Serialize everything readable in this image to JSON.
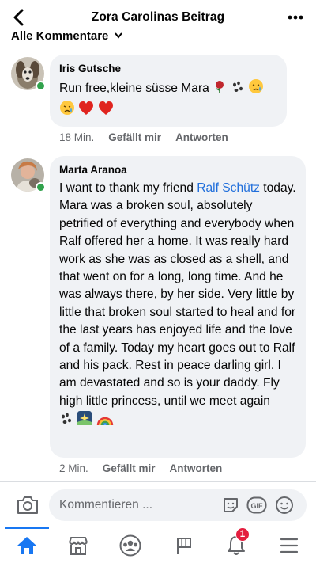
{
  "header": {
    "title": "Zora Carolinas Beitrag"
  },
  "section": {
    "label": "Alle Kommentare"
  },
  "comments": [
    {
      "author": "Iris Gutsche",
      "text_parts": [
        "Run free,kleine süsse Mara "
      ],
      "emojis_line1": [
        "rose-icon",
        "paw-prints-icon",
        "sad-tear-face-icon"
      ],
      "emojis_line2": [
        "sad-tear-face-icon",
        "red-heart-icon",
        "red-heart-icon"
      ],
      "time": "18 Min.",
      "like_label": "Gefällt mir",
      "reply_label": "Antworten",
      "online": true
    },
    {
      "author": "Marta Aranoa",
      "text_before_mention": "I want to thank my friend ",
      "mention": "Ralf Schütz",
      "text_after_mention": " today. Mara was a broken soul, absolutely petrified of everything and everybody when Ralf offered her a home. It was really hard work as she was as closed as a shell, and that went on for a long, long time. And he was always there, by her side. Very little by little that broken soul started to heal and for the last years has enjoyed life and the love of a family. Today my heart goes out to Ralf and his pack. Rest in peace  darling girl. I am devastated and so is your daddy. Fly high little princess, until we meet again",
      "emojis_end": [
        "paw-prints-icon",
        "night-sky-icon",
        "rainbow-icon"
      ],
      "time": "2 Min.",
      "like_label": "Gefällt mir",
      "reply_label": "Antworten",
      "online": true
    }
  ],
  "composer": {
    "placeholder": "Kommentieren ..."
  },
  "tabbar": {
    "items": [
      "home-icon",
      "marketplace-icon",
      "groups-icon",
      "pages-flag-icon",
      "notifications-bell-icon",
      "menu-icon"
    ],
    "notification_count": "1",
    "active": "home-icon"
  },
  "colors": {
    "accent": "#1877f2",
    "bubble": "#f0f2f5",
    "secondary_text": "#65676b",
    "online": "#31a24c",
    "badge": "#e41e3f",
    "mention": "#216fdb"
  }
}
